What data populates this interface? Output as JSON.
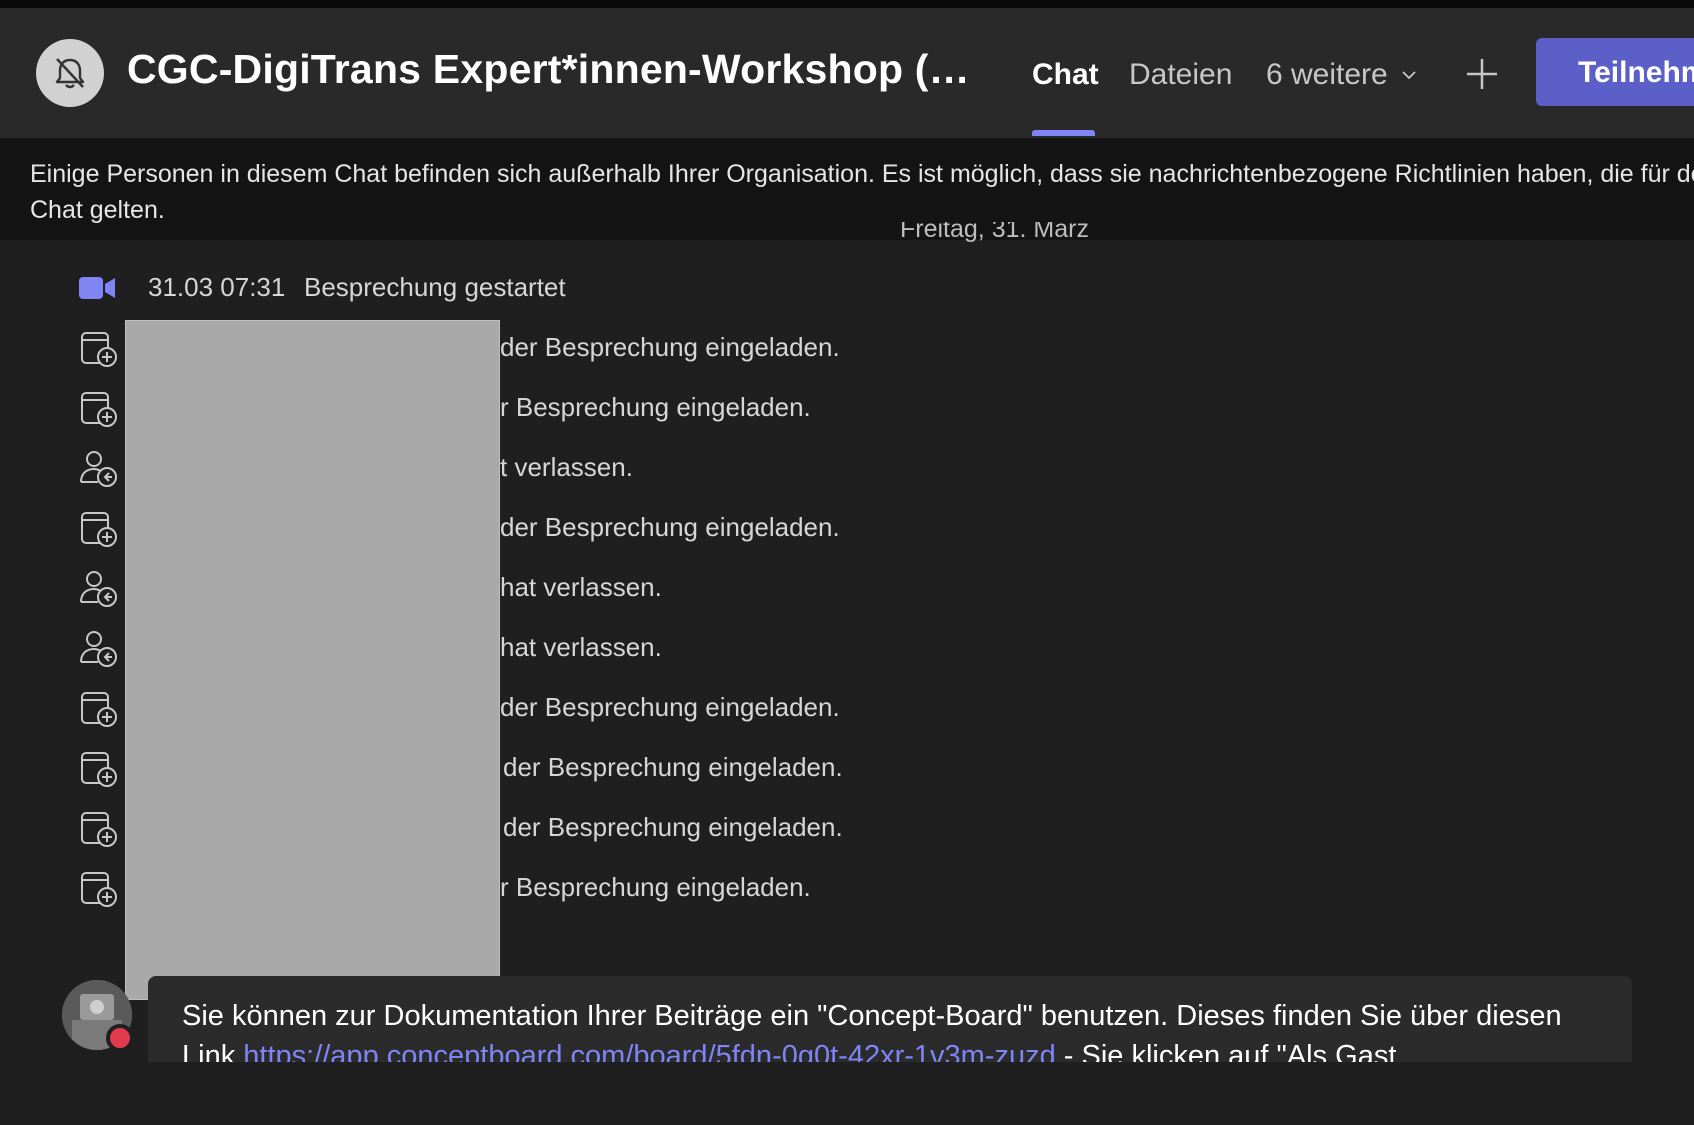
{
  "header": {
    "title": "CGC-DigiTrans Expert*innen-Workshop (…",
    "tabs": {
      "chat": "Chat",
      "files": "Dateien",
      "more": "6 weitere"
    },
    "participants_button": "Teilnehm"
  },
  "banner": {
    "text": "Einige Personen in diesem Chat befinden sich außerhalb Ihrer Organisation. Es ist möglich, dass sie nachrichtenbezogene Richtlinien haben, die für den Chat gelten."
  },
  "date_separator": "Freitag, 31. März",
  "events": [
    {
      "icon": "video-camera-icon",
      "time": "31.03 07:31",
      "text": "Besprechung gestartet"
    },
    {
      "icon": "calendar-add-icon",
      "text": "der Besprechung eingeladen."
    },
    {
      "icon": "calendar-add-icon",
      "text": "r Besprechung eingeladen."
    },
    {
      "icon": "person-leave-icon",
      "text": "t verlassen."
    },
    {
      "icon": "calendar-add-icon",
      "text": "der Besprechung eingeladen."
    },
    {
      "icon": "person-leave-icon",
      "text": "hat verlassen."
    },
    {
      "icon": "person-leave-icon",
      "text": "hat verlassen."
    },
    {
      "icon": "calendar-add-icon",
      "text": "der Besprechung eingeladen."
    },
    {
      "icon": "calendar-add-icon",
      "text": "der Besprechung eingeladen."
    },
    {
      "icon": "calendar-add-icon",
      "text": "der Besprechung eingeladen."
    },
    {
      "icon": "calendar-add-icon",
      "text": "r Besprechung eingeladen."
    }
  ],
  "message": {
    "text_before_link": "Sie können zur Dokumentation Ihrer Beiträge ein \"Concept-Board\" benutzen. Dieses finden Sie über diesen Link ",
    "link": "https://app.conceptboard.com/board/5fdn-0g0t-42xr-1v3m-zuzd",
    "text_after_link": " - Sie klicken auf \"Als Gast"
  },
  "colors": {
    "accent": "#5b5fc7",
    "tab_underline": "#7f85f5",
    "presence_busy": "#e03b4e"
  }
}
